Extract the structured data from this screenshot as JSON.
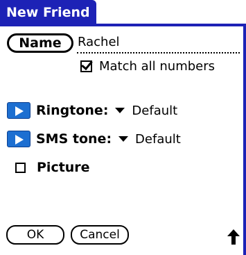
{
  "title": "New Friend",
  "name": {
    "button_label": "Name",
    "value": "Rachel"
  },
  "match_all_numbers": {
    "label": "Match all numbers",
    "checked": true
  },
  "ringtone": {
    "label": "Ringtone:",
    "value": "Default",
    "icon": "play-icon"
  },
  "sms_tone": {
    "label": "SMS tone:",
    "value": "Default",
    "icon": "play-icon"
  },
  "picture": {
    "label": "Picture",
    "checked": false
  },
  "buttons": {
    "ok": "OK",
    "cancel": "Cancel"
  },
  "colors": {
    "accent": "#1d22b6",
    "play_icon": "#1d6fd1"
  }
}
